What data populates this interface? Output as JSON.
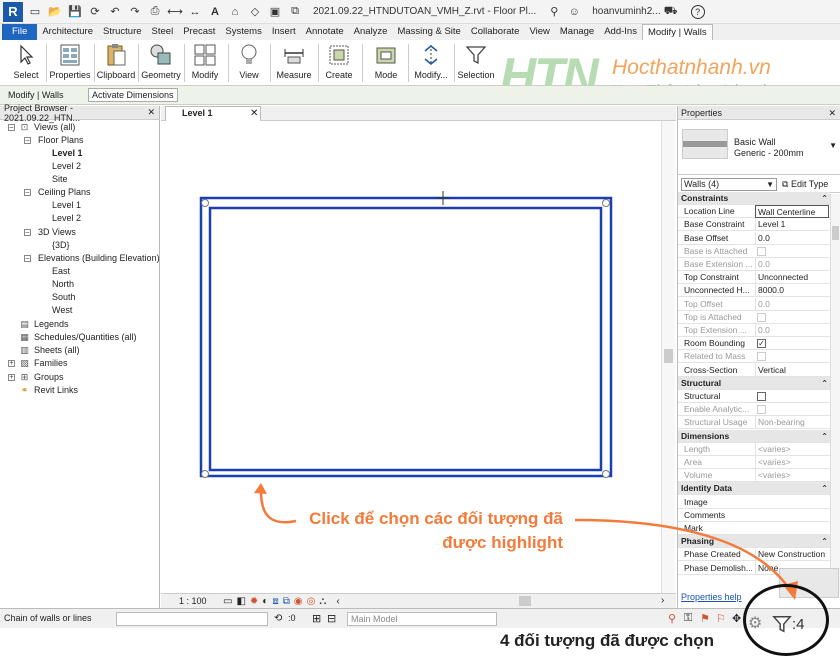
{
  "app": {
    "logo": "R",
    "title": "2021.09.22_HTNDUTOAN_VMH_Z.rvt - Floor Pl...",
    "user": "hoanvuminh2...",
    "help": "?"
  },
  "ribbon_tabs": [
    "File",
    "Architecture",
    "Structure",
    "Steel",
    "Precast",
    "Systems",
    "Insert",
    "Annotate",
    "Analyze",
    "Massing & Site",
    "Collaborate",
    "View",
    "Manage",
    "Add-Ins",
    "Modify | Walls"
  ],
  "ribbon_buttons": {
    "select": "Select",
    "properties": "Properties",
    "clipboard": "Clipboard",
    "geometry": "Geometry",
    "modify": "Modify",
    "view": "View",
    "measure": "Measure",
    "create": "Create",
    "mode": "Mode",
    "modify_dots": "Modify...",
    "selection": "Selection"
  },
  "watermark": {
    "logo": "HTN",
    "site": "Hocthatnhanh.vn",
    "slogan": "Học Thật  Làm Nhanh"
  },
  "context_bar": {
    "context": "Modify | Walls",
    "option": "Activate Dimensions"
  },
  "project_browser": {
    "title": "Project Browser - 2021.09.22_HTN...",
    "close": "✕",
    "items": [
      {
        "label": "Views (all)"
      },
      {
        "label": "Floor Plans"
      },
      {
        "label": "Level 1"
      },
      {
        "label": "Level 2"
      },
      {
        "label": "Site"
      },
      {
        "label": "Ceiling Plans"
      },
      {
        "label": "Level 1"
      },
      {
        "label": "Level 2"
      },
      {
        "label": "3D Views"
      },
      {
        "label": "{3D}"
      },
      {
        "label": "Elevations (Building Elevation)"
      },
      {
        "label": "East"
      },
      {
        "label": "North"
      },
      {
        "label": "South"
      },
      {
        "label": "West"
      },
      {
        "label": "Legends"
      },
      {
        "label": "Schedules/Quantities (all)"
      },
      {
        "label": "Sheets (all)"
      },
      {
        "label": "Families"
      },
      {
        "label": "Groups"
      },
      {
        "label": "Revit Links"
      }
    ]
  },
  "view": {
    "tab": "Level 1",
    "close": "✕",
    "scale": "1 : 100"
  },
  "properties": {
    "title": "Properties",
    "close": "✕",
    "family": "Basic Wall",
    "type": "Generic - 200mm",
    "selector": "Walls (4)",
    "edit_type": "Edit Type",
    "help": "Properties help",
    "groups": {
      "constraints": "Constraints",
      "structural": "Structural",
      "dimensions": "Dimensions",
      "identity": "Identity Data",
      "phasing": "Phasing"
    },
    "rows": {
      "location_line": {
        "name": "Location Line",
        "value": "Wall Centerline"
      },
      "base_constraint": {
        "name": "Base Constraint",
        "value": "Level 1"
      },
      "base_offset": {
        "name": "Base Offset",
        "value": "0.0"
      },
      "base_attached": {
        "name": "Base is Attached",
        "value": ""
      },
      "base_extension": {
        "name": "Base Extension ...",
        "value": "0.0"
      },
      "top_constraint": {
        "name": "Top Constraint",
        "value": "Unconnected"
      },
      "unconnected_h": {
        "name": "Unconnected H...",
        "value": "8000.0"
      },
      "top_offset": {
        "name": "Top Offset",
        "value": "0.0"
      },
      "top_attached": {
        "name": "Top is Attached",
        "value": ""
      },
      "top_extension": {
        "name": "Top Extension ...",
        "value": "0.0"
      },
      "room_bounding": {
        "name": "Room Bounding",
        "value": "✓"
      },
      "related_mass": {
        "name": "Related to Mass",
        "value": ""
      },
      "cross_section": {
        "name": "Cross-Section",
        "value": "Vertical"
      },
      "structural": {
        "name": "Structural",
        "value": ""
      },
      "enable_analytic": {
        "name": "Enable Analytic...",
        "value": ""
      },
      "structural_usage": {
        "name": "Structural Usage",
        "value": "Non-bearing"
      },
      "length": {
        "name": "Length",
        "value": "<varies>"
      },
      "area": {
        "name": "Area",
        "value": "<varies>"
      },
      "volume": {
        "name": "Volume",
        "value": "<varies>"
      },
      "image": {
        "name": "Image",
        "value": ""
      },
      "comments": {
        "name": "Comments",
        "value": ""
      },
      "mark": {
        "name": "Mark",
        "value": ""
      },
      "phase_created": {
        "name": "Phase Created",
        "value": "New Construction"
      },
      "phase_demolished": {
        "name": "Phase Demolish...",
        "value": "None"
      }
    }
  },
  "status_bar": {
    "text": "Chain of walls or lines",
    "count_zero": ":0",
    "model": "Main Model",
    "selected": ":4"
  },
  "annotations": {
    "click_hint_line1": "Click để chọn các đối tượng đã",
    "click_hint_line2": "được highlight",
    "selected_note": "4 đối tượng đã được chọn"
  },
  "colors": {
    "accent": "#1f66c1",
    "wall_selected": "#1a3fb5",
    "annotation_orange": "#f47a3a"
  }
}
